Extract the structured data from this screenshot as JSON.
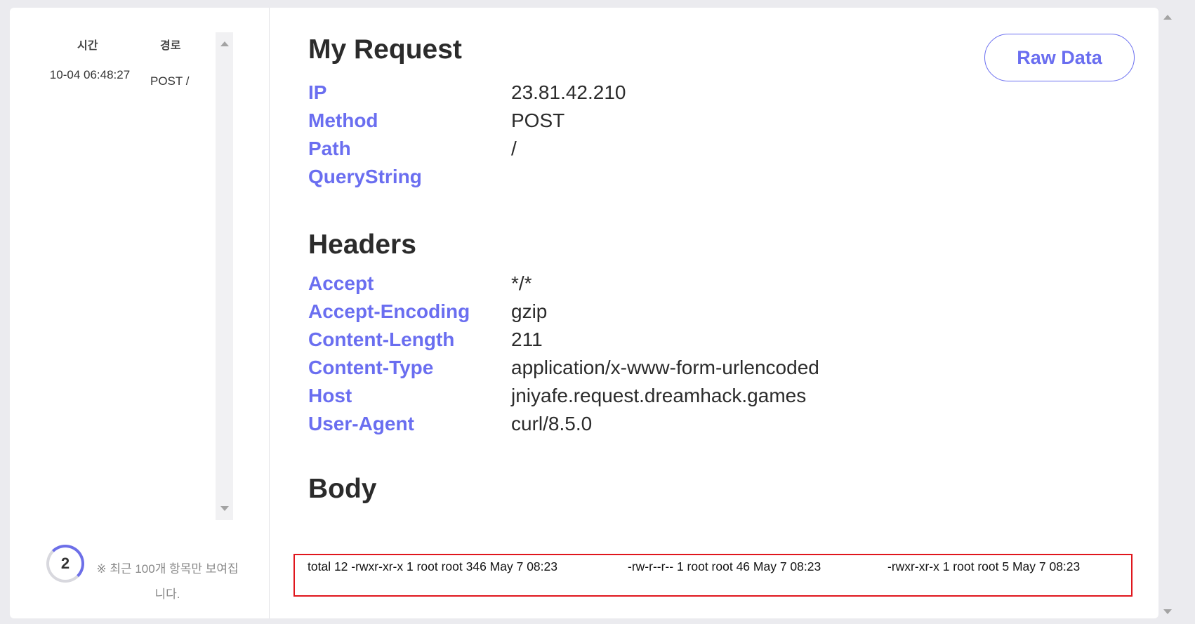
{
  "sidebar": {
    "col_time": "시간",
    "col_path": "경로",
    "requests": [
      {
        "time": "10-04 06:48:27",
        "path": "POST /"
      }
    ],
    "count": "2",
    "note": "※ 최근 100개 항목만 보여집니다."
  },
  "request": {
    "title": "My Request",
    "raw_button": "Raw Data",
    "fields": [
      {
        "key": "IP",
        "value": "23.81.42.210"
      },
      {
        "key": "Method",
        "value": "POST"
      },
      {
        "key": "Path",
        "value": "/"
      },
      {
        "key": "QueryString",
        "value": ""
      }
    ]
  },
  "headers": {
    "title": "Headers",
    "fields": [
      {
        "key": "Accept",
        "value": "*/*"
      },
      {
        "key": "Accept-Encoding",
        "value": "gzip"
      },
      {
        "key": "Content-Length",
        "value": "211"
      },
      {
        "key": "Content-Type",
        "value": "application/x-www-form-urlencoded"
      },
      {
        "key": "Host",
        "value": "jniyafe.request.dreamhack.games"
      },
      {
        "key": "User-Agent",
        "value": "curl/8.5.0"
      }
    ]
  },
  "body": {
    "title": "Body",
    "parts": [
      "total 12 -rwxr-xr-x 1 root root 346 May 7 08:23",
      "-rw-r--r-- 1 root root 46 May 7 08:23",
      "-rwxr-xr-x 1 root root 5 May 7 08:23"
    ]
  },
  "colors": {
    "accent": "#6a6ef0",
    "highlight": "#e0161d"
  }
}
